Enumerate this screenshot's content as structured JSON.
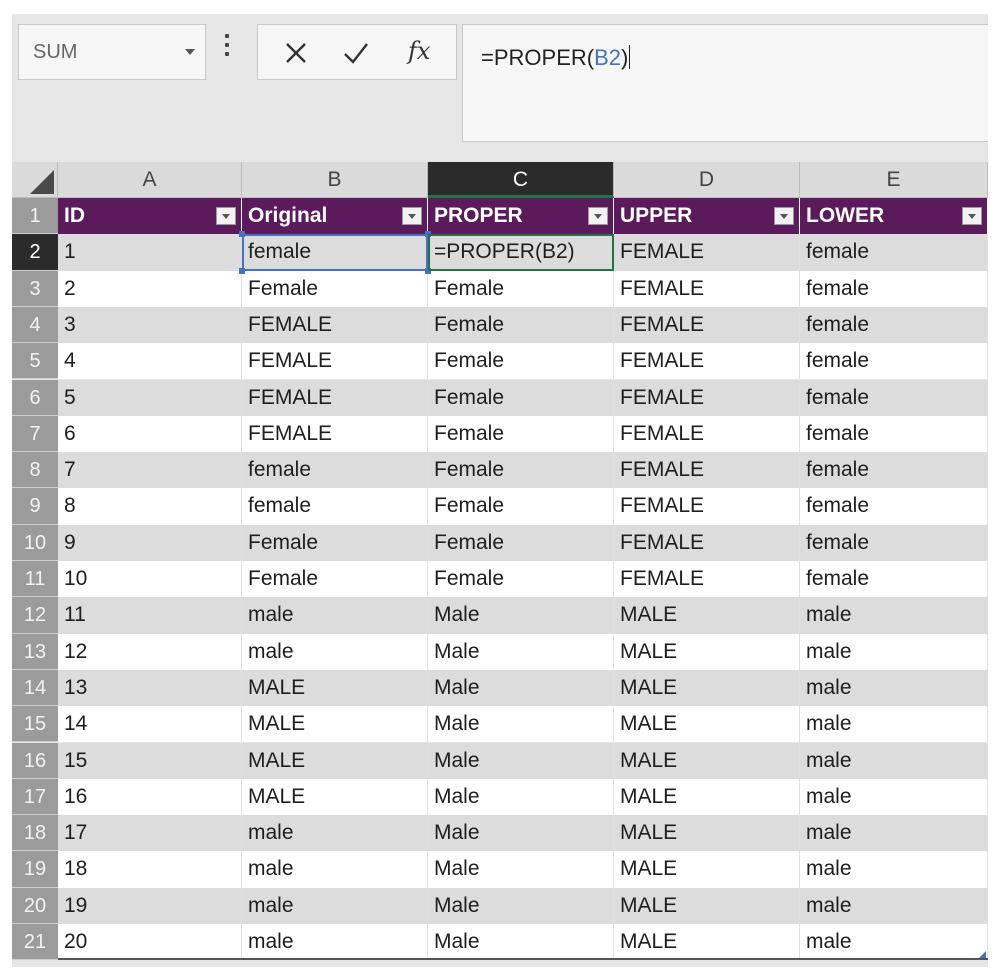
{
  "name_box": {
    "value": "SUM"
  },
  "formula_bar": {
    "cancel_icon": "x-icon",
    "enter_icon": "check-icon",
    "function_label": "fx",
    "formula_prefix": "=PROPER(",
    "formula_ref": "B2",
    "formula_suffix": ")"
  },
  "columns": [
    "A",
    "B",
    "C",
    "D",
    "E"
  ],
  "active_column": "C",
  "active_row": "2",
  "row_numbers": [
    "1",
    "2",
    "3",
    "4",
    "5",
    "6",
    "7",
    "8",
    "9",
    "10",
    "11",
    "12",
    "13",
    "14",
    "15",
    "16",
    "17",
    "18",
    "19",
    "20",
    "21"
  ],
  "table": {
    "headers": [
      "ID",
      "Original",
      "PROPER",
      "UPPER",
      "LOWER"
    ],
    "rows": [
      [
        "1",
        "female",
        "=PROPER(B2)",
        "FEMALE",
        "female"
      ],
      [
        "2",
        "Female",
        "Female",
        "FEMALE",
        "female"
      ],
      [
        "3",
        "FEMALE",
        "Female",
        "FEMALE",
        "female"
      ],
      [
        "4",
        "FEMALE",
        "Female",
        "FEMALE",
        "female"
      ],
      [
        "5",
        "FEMALE",
        "Female",
        "FEMALE",
        "female"
      ],
      [
        "6",
        "FEMALE",
        "Female",
        "FEMALE",
        "female"
      ],
      [
        "7",
        "female",
        "Female",
        "FEMALE",
        "female"
      ],
      [
        "8",
        "female",
        "Female",
        "FEMALE",
        "female"
      ],
      [
        "9",
        "Female",
        "Female",
        "FEMALE",
        "female"
      ],
      [
        "10",
        "Female",
        "Female",
        "FEMALE",
        "female"
      ],
      [
        "11",
        "male",
        "Male",
        "MALE",
        "male"
      ],
      [
        "12",
        "male",
        "Male",
        "MALE",
        "male"
      ],
      [
        "13",
        "MALE",
        "Male",
        "MALE",
        "male"
      ],
      [
        "14",
        "MALE",
        "Male",
        "MALE",
        "male"
      ],
      [
        "15",
        "MALE",
        "Male",
        "MALE",
        "male"
      ],
      [
        "16",
        "MALE",
        "Male",
        "MALE",
        "male"
      ],
      [
        "17",
        "male",
        "Male",
        "MALE",
        "male"
      ],
      [
        "18",
        "male",
        "Male",
        "MALE",
        "male"
      ],
      [
        "19",
        "male",
        "Male",
        "MALE",
        "male"
      ],
      [
        "20",
        "male",
        "Male",
        "MALE",
        "male"
      ]
    ]
  },
  "colors": {
    "table_header": "#5b1a5c",
    "band_row": "#dcdcdc",
    "plain_row": "#ffffff",
    "formula_ref": "#4472c4",
    "active_cell_border": "#217346"
  }
}
